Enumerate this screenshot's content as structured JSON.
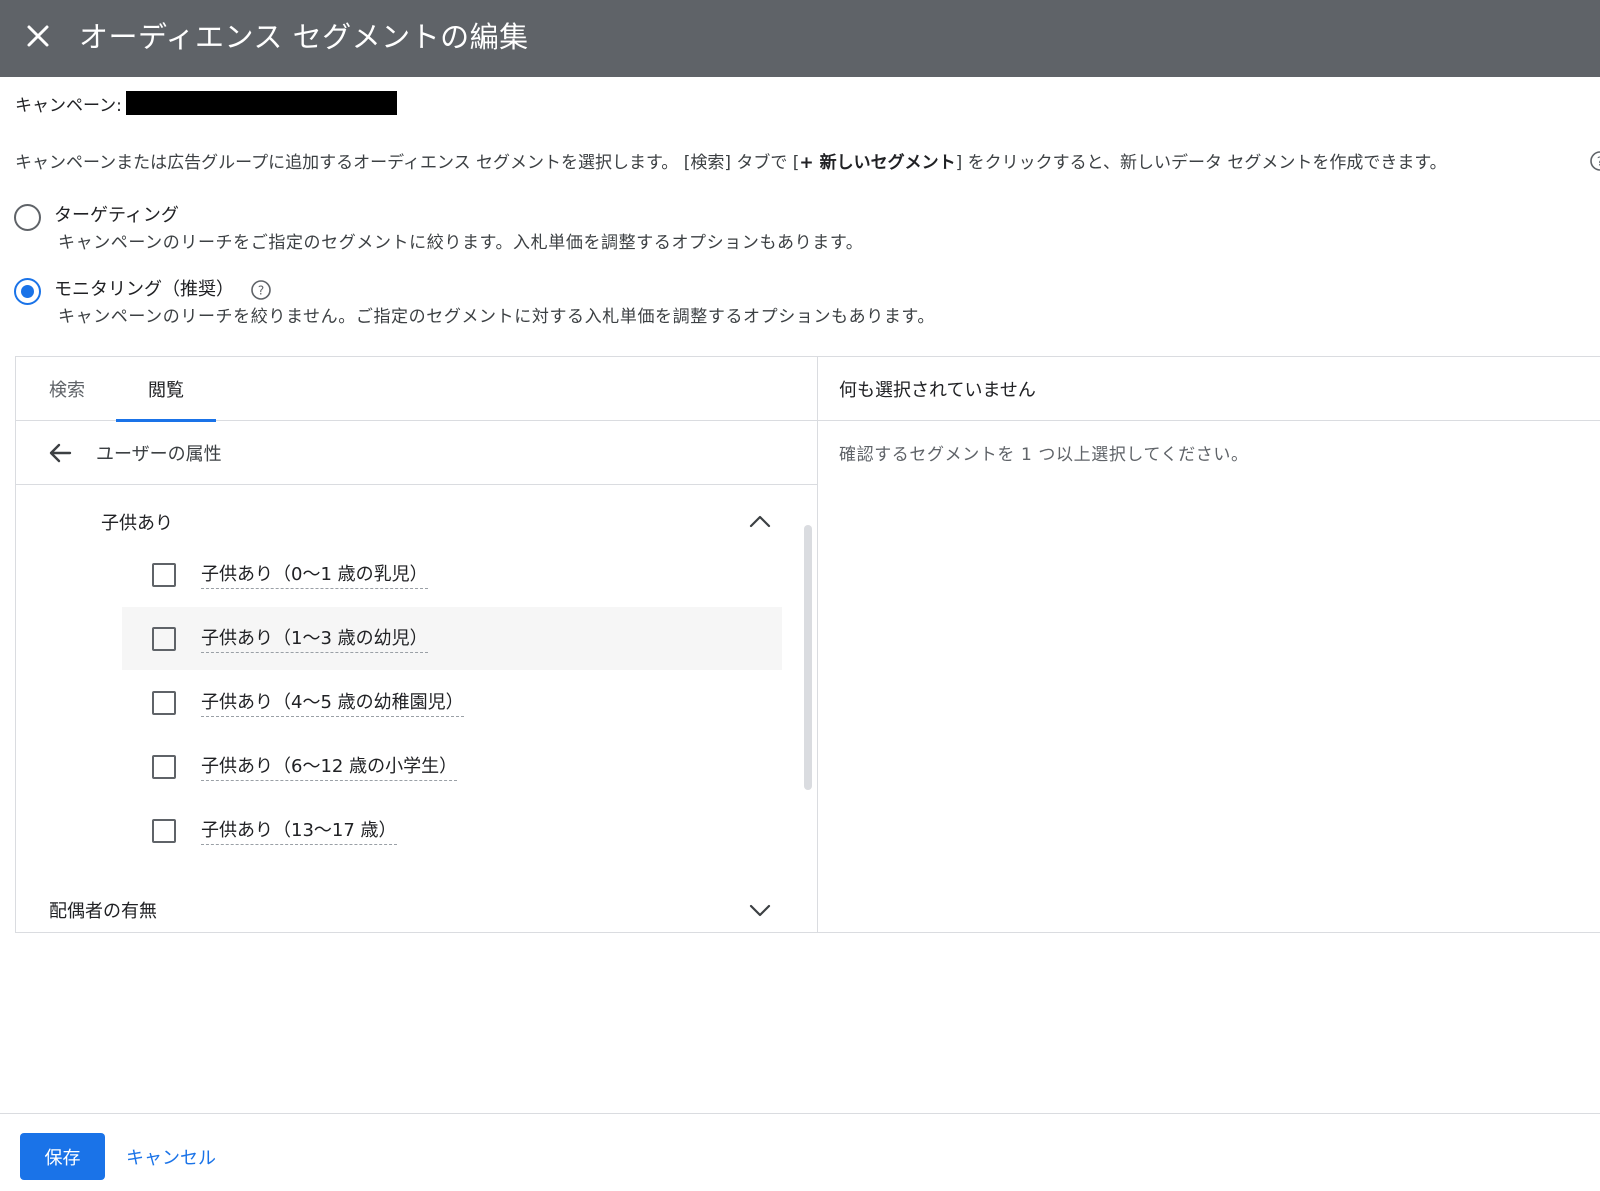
{
  "header": {
    "title": "オーディエンス セグメントの編集",
    "close_icon": "close-icon"
  },
  "campaign": {
    "label": "キャンペーン:"
  },
  "description": {
    "part1": "キャンペーンまたは広告グループに追加するオーディエンス セグメントを選択します。 [検索] タブで [",
    "bold": "+ 新しいセグメント",
    "part2": "] をクリックすると、新しいデータ セグメントを作成できます。"
  },
  "modes": [
    {
      "label": "ターゲティング",
      "desc": "キャンペーンのリーチをご指定のセグメントに絞ります。入札単価を調整するオプションもあります。",
      "checked": false
    },
    {
      "label": "モニタリング（推奨）",
      "desc": "キャンペーンのリーチを絞りません。ご指定のセグメントに対する入札単価を調整するオプションもあります。",
      "checked": true
    }
  ],
  "tabs": [
    {
      "label": "検索",
      "active": false
    },
    {
      "label": "閲覧",
      "active": true
    }
  ],
  "breadcrumb": {
    "label": "ユーザーの属性"
  },
  "groups": [
    {
      "label": "子供あり",
      "expanded": true,
      "options": [
        "子供あり（0〜1 歳の乳児）",
        "子供あり（1〜3 歳の幼児）",
        "子供あり（4〜5 歳の幼稚園児）",
        "子供あり（6〜12 歳の小学生）",
        "子供あり（13〜17 歳）"
      ]
    },
    {
      "label": "配偶者の有無",
      "expanded": false
    }
  ],
  "selection": {
    "header": "何も選択されていません",
    "empty_message": "確認するセグメントを 1 つ以上選択してください。"
  },
  "footer": {
    "save_label": "保存",
    "cancel_label": "キャンセル"
  },
  "colors": {
    "header_bg": "#5f6368",
    "accent": "#1a73e8"
  }
}
